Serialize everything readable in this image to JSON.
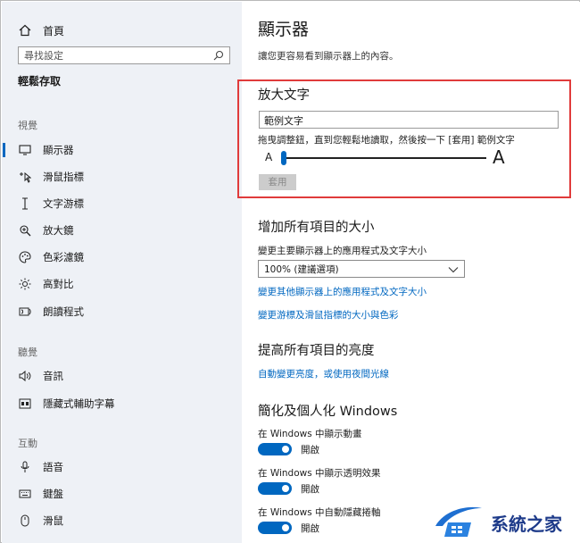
{
  "sidebar": {
    "home_label": "首頁",
    "search_placeholder": "尋找設定",
    "section_title": "輕鬆存取",
    "groups": {
      "vision": "視覺",
      "hearing": "聽覺",
      "interaction": "互動"
    },
    "items": [
      {
        "id": "display",
        "icon": "monitor-icon",
        "label": "顯示器",
        "active": true
      },
      {
        "id": "mouse-pointer",
        "icon": "cursor-icon",
        "label": "滑鼠指標"
      },
      {
        "id": "text-cursor",
        "icon": "text-cursor-icon",
        "label": "文字游標"
      },
      {
        "id": "magnifier",
        "icon": "magnifier-icon",
        "label": "放大鏡"
      },
      {
        "id": "color-filters",
        "icon": "palette-icon",
        "label": "色彩濾鏡"
      },
      {
        "id": "high-contrast",
        "icon": "sun-icon",
        "label": "高對比"
      },
      {
        "id": "narrator",
        "icon": "narrator-icon",
        "label": "朗讀程式"
      },
      {
        "id": "audio",
        "icon": "speaker-icon",
        "label": "音訊"
      },
      {
        "id": "captions",
        "icon": "captions-icon",
        "label": "隱藏式輔助字幕"
      },
      {
        "id": "speech",
        "icon": "microphone-icon",
        "label": "語音"
      },
      {
        "id": "keyboard",
        "icon": "keyboard-icon",
        "label": "鍵盤"
      },
      {
        "id": "mouse",
        "icon": "mouse-icon",
        "label": "滑鼠"
      }
    ]
  },
  "main": {
    "title": "顯示器",
    "description": "讓您更容易看到顯示器上的內容。",
    "text_size": {
      "heading": "放大文字",
      "sample_text": "範例文字",
      "instruction": "拖曳調整鈕，直到您輕鬆地讀取，然後按一下 [套用] 範例文字",
      "small_a": "A",
      "big_a": "A",
      "slider_value_percent": 0,
      "apply_label": "套用"
    },
    "make_bigger": {
      "heading": "增加所有項目的大小",
      "label": "變更主要顯示器上的應用程式及文字大小",
      "selected_option": "100% (建議選項)",
      "link1": "變更其他顯示器上的應用程式及文字大小",
      "link2": "變更游標及滑鼠指標的大小與色彩"
    },
    "brightness": {
      "heading": "提高所有項目的亮度",
      "link": "自動變更亮度，或使用夜間光線"
    },
    "personalize": {
      "heading": "簡化及個人化 Windows",
      "toggles": [
        {
          "label": "在 Windows 中顯示動畫",
          "state": "開啟"
        },
        {
          "label": "在 Windows 中顯示透明效果",
          "state": "開啟"
        },
        {
          "label": "在 Windows 中自動隱藏捲軸",
          "state": "開啟"
        }
      ]
    }
  },
  "watermark": {
    "text": "系統之家"
  },
  "colors": {
    "accent": "#0067c0",
    "highlight_border": "#e03b3b",
    "sidebar_bg": "#eef1f6"
  }
}
